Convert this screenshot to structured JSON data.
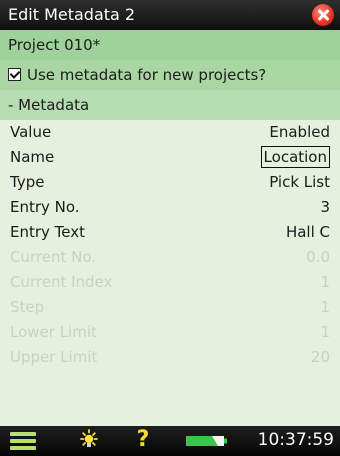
{
  "window": {
    "title": "Edit Metadata 2"
  },
  "project": {
    "name": "Project 010*"
  },
  "use_metadata": {
    "label": "Use metadata for new projects?",
    "checked": true
  },
  "section": {
    "label": "- Metadata"
  },
  "rows": [
    {
      "label": "Value",
      "value": "Enabled",
      "enabled": true
    },
    {
      "label": "Name",
      "value": "Location",
      "enabled": true,
      "focused": true
    },
    {
      "label": "Type",
      "value": "Pick List",
      "enabled": true
    },
    {
      "label": "Entry No.",
      "value": "3",
      "enabled": true
    },
    {
      "label": "Entry Text",
      "value": "Hall C",
      "enabled": true
    },
    {
      "label": "Current No.",
      "value": "0.0",
      "enabled": false
    },
    {
      "label": "Current Index",
      "value": "1",
      "enabled": false
    },
    {
      "label": "Step",
      "value": "1",
      "enabled": false
    },
    {
      "label": "Lower Limit",
      "value": "1",
      "enabled": false
    },
    {
      "label": "Upper Limit",
      "value": "20",
      "enabled": false
    }
  ],
  "taskbar": {
    "help_symbol": "?",
    "time": "10:37:59",
    "icons": [
      "menu-icon",
      "brightness-icon",
      "help-icon",
      "battery-icon"
    ]
  },
  "colors": {
    "background": "#e6f0df",
    "band_green": "#9fd19a",
    "disabled_text": "#c7d3c1",
    "close_red": "#e33222"
  }
}
